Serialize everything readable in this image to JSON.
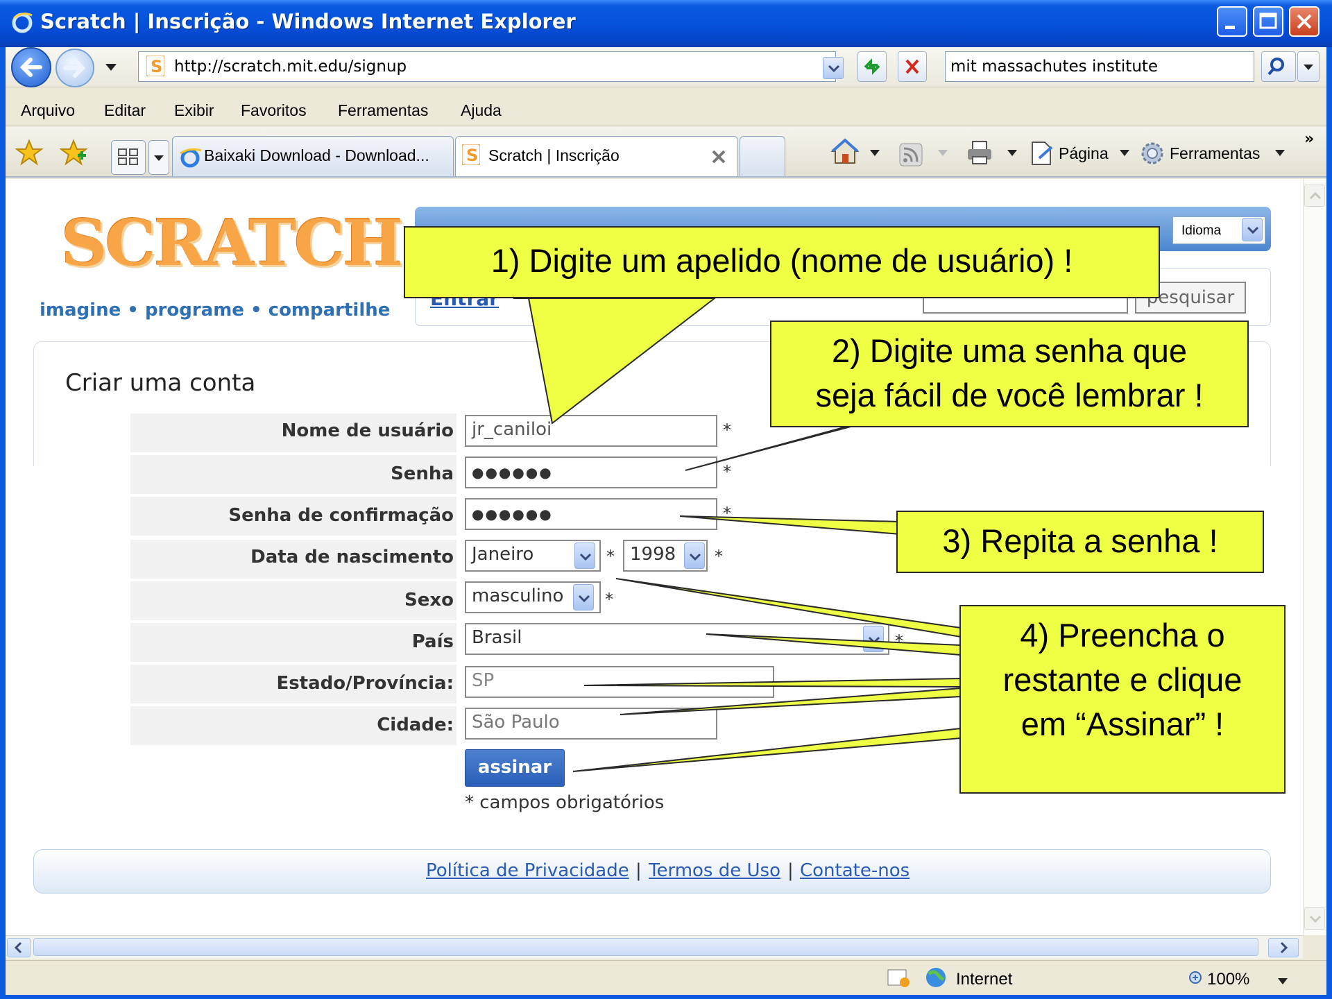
{
  "browser": {
    "title": "Scratch | Inscrição - Windows Internet Explorer",
    "url": "http://scratch.mit.edu/signup",
    "search_query": "mit massachutes institute",
    "menu": [
      "Arquivo",
      "Editar",
      "Exibir",
      "Favoritos",
      "Ferramentas",
      "Ajuda"
    ],
    "tabs": [
      {
        "label": "Baixaki Download - Download...",
        "active": false
      },
      {
        "label": "Scratch | Inscrição",
        "active": true
      }
    ],
    "toolbar": {
      "pagina": "Página",
      "ferramentas": "Ferramentas",
      "more": "»"
    },
    "status": {
      "zone": "Internet",
      "zoom": "100%"
    }
  },
  "site": {
    "logo": "SCRATCH",
    "tagline": "imagine • programe • compartilhe",
    "language_label": "Idioma",
    "login_link": "Entrar",
    "search_button": "pesquisar"
  },
  "form": {
    "title": "Criar uma conta",
    "fields": {
      "username": {
        "label": "Nome de usuário",
        "value": "jr_caniloi"
      },
      "password": {
        "label": "Senha",
        "value": "●●●●●●"
      },
      "password_confirm": {
        "label": "Senha de confirmação",
        "value": "●●●●●●"
      },
      "birth": {
        "label": "Data de nascimento",
        "month": "Janeiro",
        "year": "1998"
      },
      "sex": {
        "label": "Sexo",
        "value": "masculino"
      },
      "country": {
        "label": "País",
        "value": "Brasil"
      },
      "state": {
        "label": "Estado/Província:",
        "value": "SP"
      },
      "city": {
        "label": "Cidade:",
        "value": "São Paulo"
      }
    },
    "required_mark": "*",
    "submit_label": "assinar",
    "required_note": "* campos obrigatórios"
  },
  "footer": {
    "links": [
      "Política de Privacidade",
      "Termos de Uso",
      "Contate-nos"
    ],
    "separator": "|"
  },
  "callouts": {
    "c1": "1) Digite um apelido (nome de usuário) !",
    "c2_line1": "2) Digite uma senha que",
    "c2_line2": "seja fácil de você lembrar !",
    "c3": "3) Repita a senha !",
    "c4_line1": "4) Preencha o",
    "c4_line2": "restante e clique",
    "c4_line3": "em “Assinar” !"
  },
  "colors": {
    "callout_fill": "#eeff44",
    "titlebar": "#0a5be0",
    "link": "#2a5bb4"
  }
}
